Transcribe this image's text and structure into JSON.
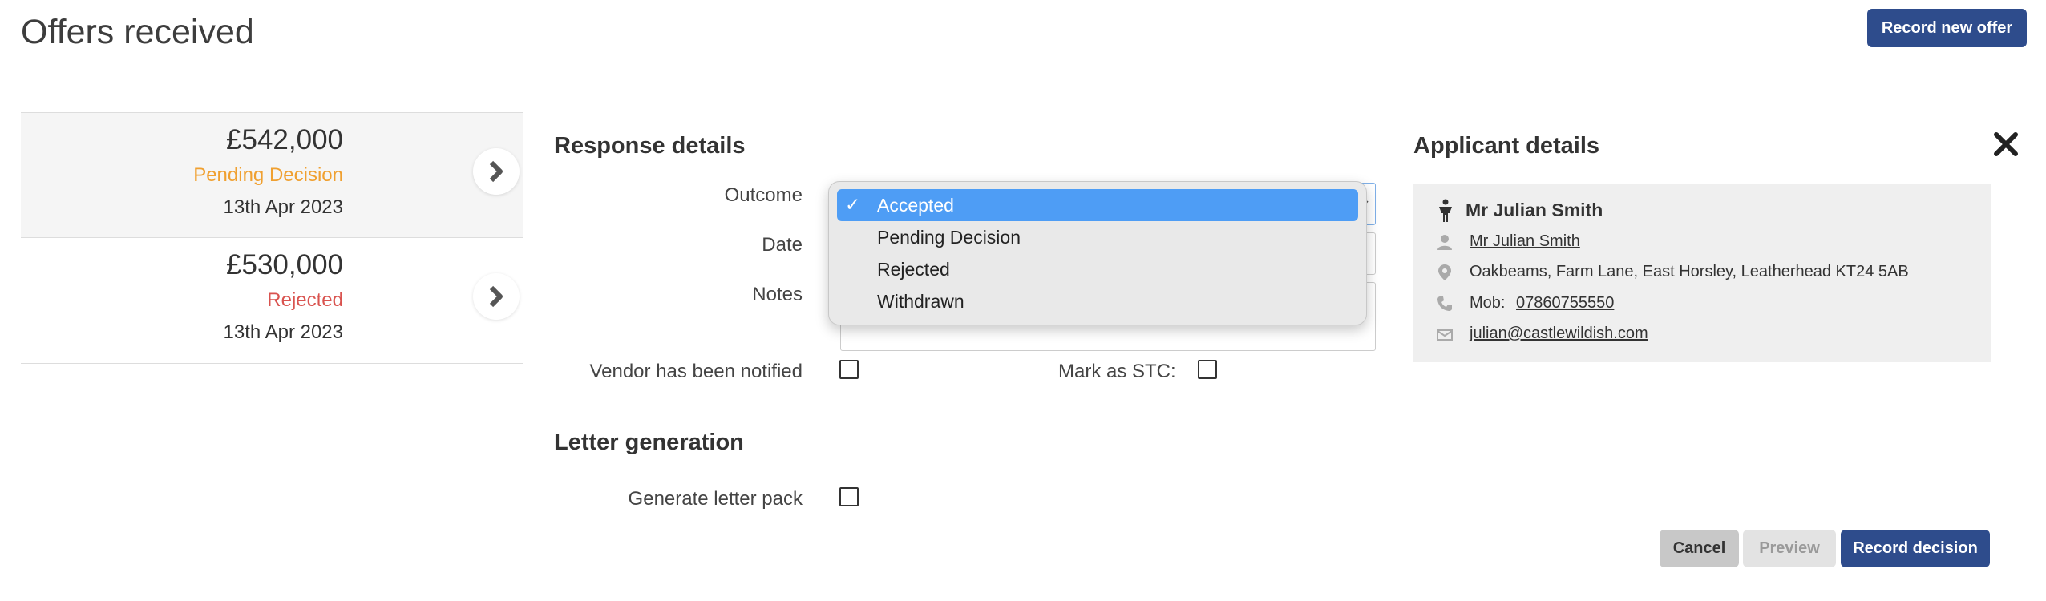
{
  "page": {
    "title": "Offers received",
    "record_new_offer_label": "Record new offer"
  },
  "offers": [
    {
      "amount": "£542,000",
      "status": "Pending Decision",
      "date": "13th Apr 2023"
    },
    {
      "amount": "£530,000",
      "status": "Rejected",
      "date": "13th Apr 2023"
    }
  ],
  "response": {
    "heading": "Response details",
    "outcome_label": "Outcome",
    "date_label": "Date",
    "notes_label": "Notes",
    "vendor_notified_label": "Vendor has been notified",
    "mark_stc_label": "Mark as STC:",
    "outcome_options": [
      "Accepted",
      "Pending Decision",
      "Rejected",
      "Withdrawn"
    ],
    "outcome_selected": "Accepted",
    "check_mark": "✓"
  },
  "letter": {
    "heading": "Letter generation",
    "generate_label": "Generate letter pack"
  },
  "applicant": {
    "heading": "Applicant details",
    "name_heading": "Mr Julian Smith",
    "name_link": "Mr Julian Smith",
    "address": "Oakbeams, Farm Lane, East Horsley, Leatherhead KT24 5AB",
    "mobile_label": "Mob:",
    "mobile": "07860755550",
    "email": "julian@castlewildish.com"
  },
  "actions": {
    "cancel": "Cancel",
    "preview": "Preview",
    "record_decision": "Record decision"
  },
  "colors": {
    "primary": "#2e4c8c",
    "pending": "#f0a030",
    "rejected": "#d9534f",
    "dropdown_selected": "#4e9df5"
  }
}
